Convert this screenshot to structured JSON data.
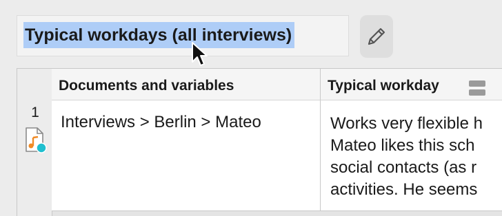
{
  "title": {
    "text": "Typical workdays (all interviews)"
  },
  "edit_button": {
    "icon": "pencil-icon"
  },
  "table": {
    "columns": [
      "Documents and variables",
      "Typical workday"
    ],
    "rows": [
      {
        "number": "1",
        "document": "Interviews > Berlin > Mateo",
        "document_icon": "audio-document-icon",
        "summary_lines": [
          "Works very flexible h",
          "Mateo likes this sch",
          "social contacts (as r",
          "activities. He seems"
        ]
      }
    ]
  },
  "colors": {
    "selection": "#aecdf7",
    "document_icon_orange": "#f08a24",
    "document_icon_teal": "#1fbfcf"
  }
}
